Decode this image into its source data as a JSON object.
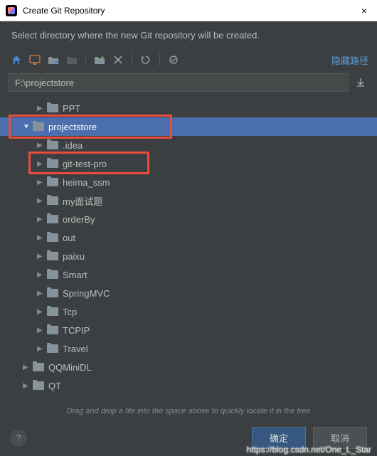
{
  "window": {
    "title": "Create Git Repository",
    "close": "×"
  },
  "instruction": "Select directory where the new Git repository will be created.",
  "toolbar": {
    "hide_path": "隐藏路径"
  },
  "path": "F:\\projectstore",
  "tree": {
    "items": [
      {
        "label": "PPT",
        "indent": 52,
        "expanded": false
      },
      {
        "label": "projectstore",
        "indent": 32,
        "expanded": true,
        "selected": true,
        "highlight": "red1"
      },
      {
        "label": ".idea",
        "indent": 52,
        "expanded": false
      },
      {
        "label": "git-test-pro",
        "indent": 52,
        "expanded": false,
        "highlight": "red2"
      },
      {
        "label": "heima_ssm",
        "indent": 52,
        "expanded": false
      },
      {
        "label": "my面试题",
        "indent": 52,
        "expanded": false
      },
      {
        "label": "orderBy",
        "indent": 52,
        "expanded": false
      },
      {
        "label": "out",
        "indent": 52,
        "expanded": false
      },
      {
        "label": "paixu",
        "indent": 52,
        "expanded": false
      },
      {
        "label": "Smart",
        "indent": 52,
        "expanded": false
      },
      {
        "label": "SpringMVC",
        "indent": 52,
        "expanded": false
      },
      {
        "label": "Tcp",
        "indent": 52,
        "expanded": false
      },
      {
        "label": "TCPIP",
        "indent": 52,
        "expanded": false
      },
      {
        "label": "Travel",
        "indent": 52,
        "expanded": false
      },
      {
        "label": "QQMiniDL",
        "indent": 32,
        "expanded": false
      },
      {
        "label": "QT",
        "indent": 32,
        "expanded": false
      }
    ]
  },
  "hint": "Drag and drop a file into the space above to quickly locate it in the tree",
  "buttons": {
    "ok": "确定",
    "cancel": "取消",
    "help": "?"
  },
  "watermark": "https://blog.csdn.net/One_L_Star"
}
